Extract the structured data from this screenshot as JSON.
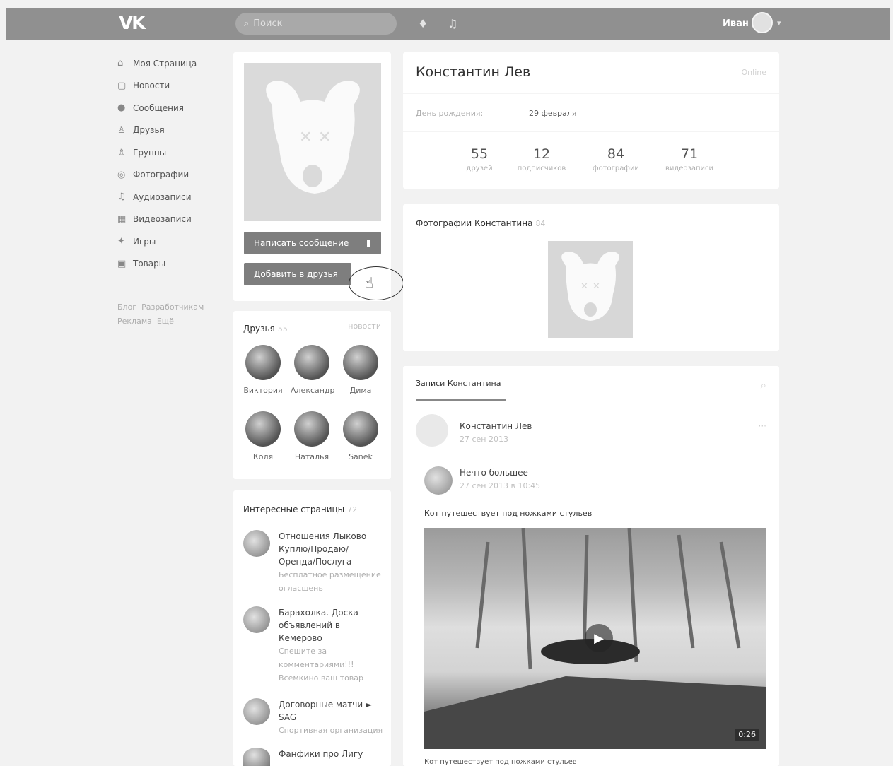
{
  "topbar": {
    "logo": "VK",
    "search_placeholder": "Поиск",
    "user_name": "Иван"
  },
  "sidebar": {
    "items": [
      {
        "label": "Моя Страница",
        "icon": "home-icon"
      },
      {
        "label": "Новости",
        "icon": "news-icon"
      },
      {
        "label": "Сообщения",
        "icon": "messages-icon"
      },
      {
        "label": "Друзья",
        "icon": "friends-icon"
      },
      {
        "label": "Группы",
        "icon": "groups-icon"
      },
      {
        "label": "Фотографии",
        "icon": "photo-icon"
      },
      {
        "label": "Аудиозаписи",
        "icon": "music-icon"
      },
      {
        "label": "Видеозаписи",
        "icon": "video-icon"
      },
      {
        "label": "Игры",
        "icon": "games-icon"
      },
      {
        "label": "Товары",
        "icon": "goods-icon"
      }
    ],
    "footer": [
      "Блог",
      "Разработчикам",
      "Реклама",
      "Ещё"
    ]
  },
  "profile": {
    "send_message": "Написать сообщение",
    "add_friend": "Добавить в друзья"
  },
  "friends": {
    "title": "Друзья",
    "count": "55",
    "link": "новости",
    "items": [
      "Виктория",
      "Александр",
      "Дима",
      "Коля",
      "Наталья",
      "Sanek"
    ]
  },
  "pages": {
    "title": "Интересные страницы",
    "count": "72",
    "items": [
      {
        "title": "Отношения Лыково Куплю/Продаю/Оренда/Послуга",
        "sub": "Бесплатное размещение огласшень"
      },
      {
        "title": "Барахолка. Доска объявлений в Кемерово",
        "sub": "Спешите за комментариями!!! Всемкино ваш товар"
      },
      {
        "title": "Договорные матчи ► SAG",
        "sub": "Спортивная организация"
      },
      {
        "title": "Фанфики про Лигу",
        "sub": ""
      }
    ]
  },
  "info": {
    "name": "Константин Лев",
    "status": "Online",
    "birthday_label": "День рождения:",
    "birthday_value": "29 февраля",
    "stats": [
      {
        "num": "55",
        "label": "друзей"
      },
      {
        "num": "12",
        "label": "подписчиков"
      },
      {
        "num": "84",
        "label": "фотографии"
      },
      {
        "num": "71",
        "label": "видеозаписи"
      }
    ]
  },
  "photos": {
    "title": "Фотографии Константина",
    "count": "84"
  },
  "wall": {
    "tab": "Записи Константина",
    "post_author": "Константин Лев",
    "post_date": "27 сен 2013",
    "repost_author": "Нечто большее",
    "repost_date": "27 сен 2013 в 10:45",
    "text": "Кот путешествует под ножками стульев",
    "duration": "0:26",
    "caption": "Кот путешествует под ножками стульев"
  }
}
